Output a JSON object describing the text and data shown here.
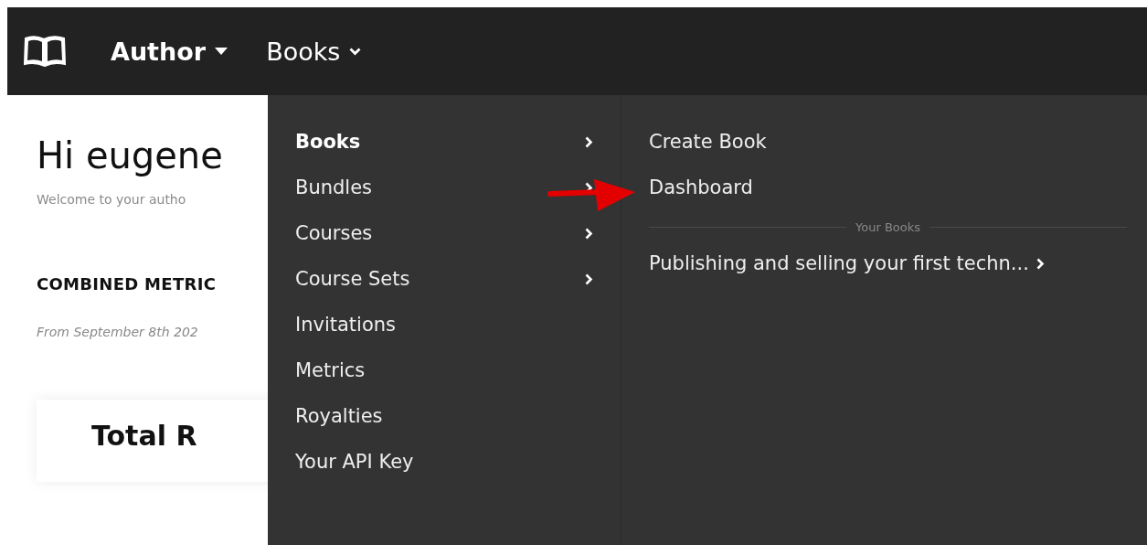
{
  "navbar": {
    "menus": [
      {
        "label": "Author",
        "kind": "brand"
      },
      {
        "label": "Books",
        "kind": "dropdown"
      }
    ]
  },
  "page": {
    "greeting": "Hi eugene",
    "subtitle": "Welcome to your autho",
    "section_title": "COMBINED METRIC",
    "date_range": "From September 8th 202",
    "card_title": "Total R"
  },
  "dropdown": {
    "categories": [
      {
        "label": "Books",
        "selected": true,
        "has_submenu": true
      },
      {
        "label": "Bundles",
        "selected": false,
        "has_submenu": true
      },
      {
        "label": "Courses",
        "selected": false,
        "has_submenu": true
      },
      {
        "label": "Course Sets",
        "selected": false,
        "has_submenu": true
      },
      {
        "label": "Invitations",
        "selected": false,
        "has_submenu": false
      },
      {
        "label": "Metrics",
        "selected": false,
        "has_submenu": false
      },
      {
        "label": "Royalties",
        "selected": false,
        "has_submenu": false
      },
      {
        "label": "Your API Key",
        "selected": false,
        "has_submenu": false
      }
    ],
    "submenu": {
      "items": [
        {
          "label": "Create Book"
        },
        {
          "label": "Dashboard"
        }
      ],
      "section_label": "Your Books",
      "books": [
        {
          "label": "Publishing and selling your first techn...",
          "has_submenu": true
        }
      ]
    }
  }
}
